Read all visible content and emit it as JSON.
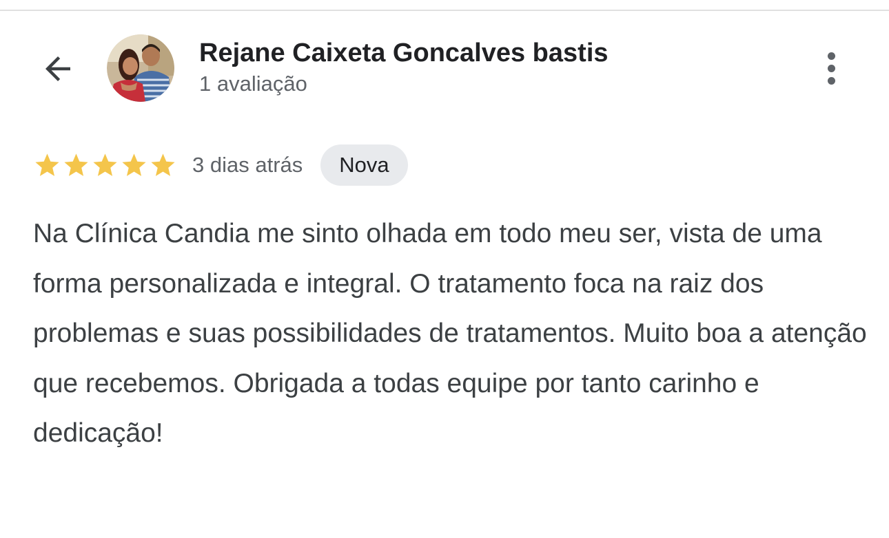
{
  "header": {
    "back_icon": "arrow-back-icon",
    "more_icon": "more-vert-icon"
  },
  "reviewer": {
    "name": "Rejane Caixeta Goncalves bastis",
    "review_count": "1 avaliação",
    "avatar": "couple-photo"
  },
  "review": {
    "rating": 5,
    "rating_max": 5,
    "star_color": "#f4c54b",
    "date": "3 dias atrás",
    "badge": "Nova",
    "text": "Na Clínica Candia me sinto olhada em todo meu ser, vista de uma forma personalizada e integral. O tratamento foca na raiz dos problemas e suas possibilidades de tratamentos. Muito boa a atenção que recebemos. Obrigada a todas equipe por tanto carinho e dedicação!"
  }
}
